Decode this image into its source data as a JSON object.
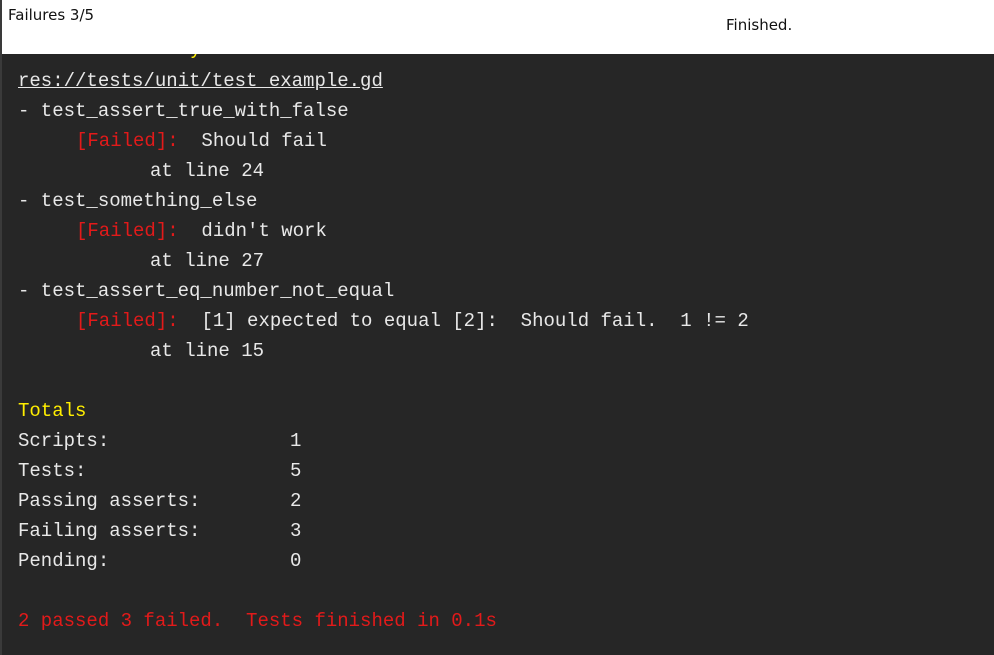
{
  "header": {
    "failures": "Failures 3/5",
    "status": "Finished."
  },
  "log": {
    "section_title_partial": "Run Summary",
    "script_path": "res://tests/unit/test_example.gd",
    "tests": [
      {
        "name": "- test_assert_true_with_false",
        "tag": "[Failed]:",
        "message": " Should fail",
        "location": "at line 24"
      },
      {
        "name": "- test_something_else",
        "tag": "[Failed]:",
        "message": " didn't work",
        "location": "at line 27"
      },
      {
        "name": "- test_assert_eq_number_not_equal",
        "tag": "[Failed]:",
        "message": " [1] expected to equal [2]:  Should fail.  1 != 2",
        "location": "at line 15"
      }
    ],
    "totals_title": "Totals",
    "totals": [
      {
        "label": "Scripts:",
        "value": "1"
      },
      {
        "label": "Tests:",
        "value": "5"
      },
      {
        "label": "Passing asserts:",
        "value": "2"
      },
      {
        "label": "Failing asserts:",
        "value": "3"
      },
      {
        "label": "Pending:",
        "value": "0"
      }
    ],
    "summary": "2 passed 3 failed.  Tests finished in 0.1s"
  },
  "colors": {
    "background": "#262626",
    "text": "#e8e8e8",
    "heading": "#ffee00",
    "failed": "#e21a1a"
  }
}
